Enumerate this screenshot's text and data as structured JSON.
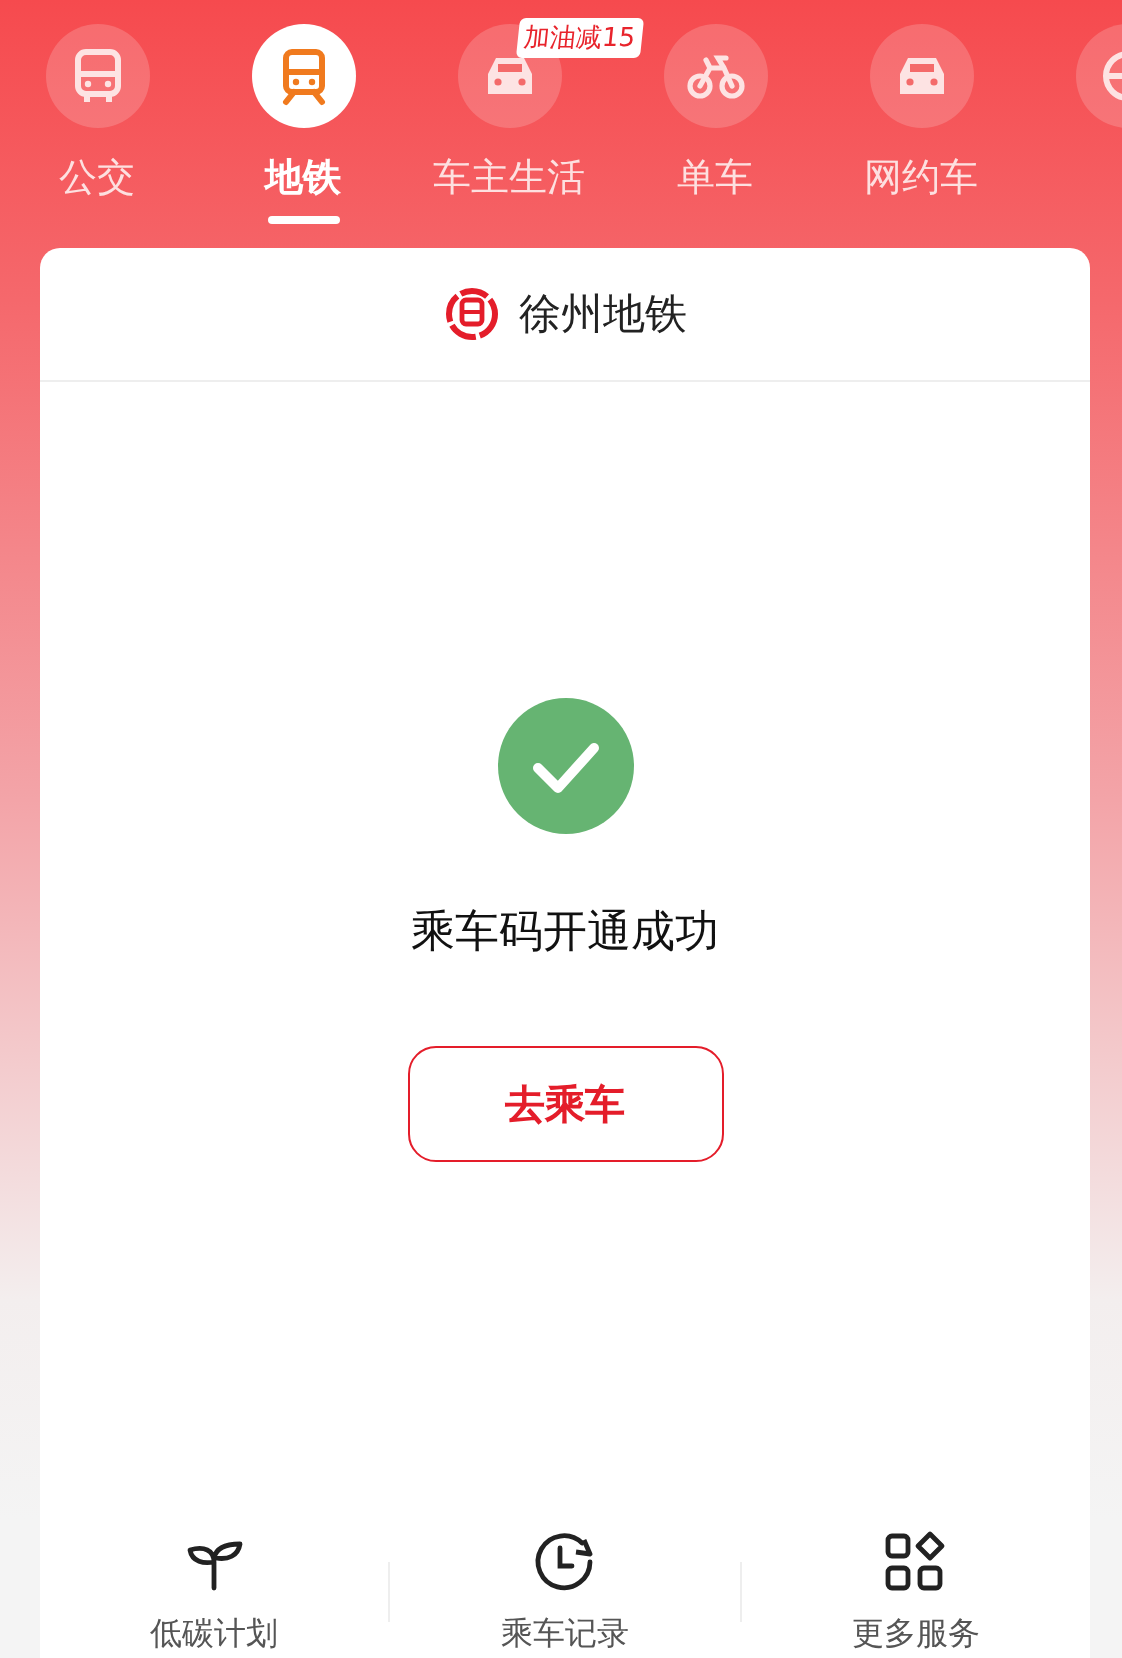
{
  "tabs": [
    {
      "label": "公交",
      "kind": "bus",
      "selected": false
    },
    {
      "label": "地铁",
      "kind": "metro",
      "selected": true
    },
    {
      "label": "车主生活",
      "kind": "car-life",
      "selected": false,
      "badge": "加油减15"
    },
    {
      "label": "单车",
      "kind": "bike",
      "selected": false
    },
    {
      "label": "网约车",
      "kind": "car",
      "selected": false
    },
    {
      "kind": "drive",
      "selected": false
    }
  ],
  "card": {
    "title": "徐州地铁",
    "status": "乘车码开通成功",
    "action": "去乘车"
  },
  "shortcuts": [
    {
      "label": "低碳计划",
      "kind": "sprout"
    },
    {
      "label": "乘车记录",
      "kind": "history"
    },
    {
      "label": "更多服务",
      "kind": "apps"
    }
  ]
}
